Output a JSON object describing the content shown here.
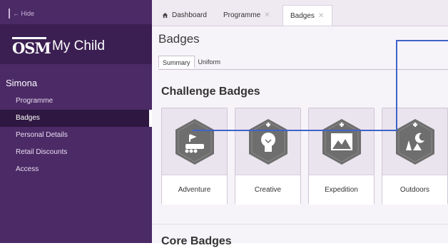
{
  "sidebar": {
    "hide_label": "← Hide",
    "logo_text": "OSM",
    "title": "My Child",
    "child_name": "Simona",
    "items": [
      {
        "label": "Programme"
      },
      {
        "label": "Badges"
      },
      {
        "label": "Personal Details"
      },
      {
        "label": "Retail Discounts"
      },
      {
        "label": "Access"
      }
    ]
  },
  "tabs": [
    {
      "label": "Dashboard",
      "icon": "home-icon",
      "closable": false
    },
    {
      "label": "Programme",
      "closable": true
    },
    {
      "label": "Badges",
      "closable": true,
      "active": true
    }
  ],
  "main": {
    "page_title": "Badges",
    "subtabs": [
      {
        "label": "Summary",
        "active": true
      },
      {
        "label": "Uniform"
      }
    ],
    "section_title": "Challenge Badges",
    "badges": [
      {
        "label": "Adventure",
        "icon": "adventure-icon"
      },
      {
        "label": "Creative",
        "icon": "lightbulb-icon"
      },
      {
        "label": "Expedition",
        "icon": "mountain-icon"
      },
      {
        "label": "Outdoors",
        "icon": "camp-night-icon"
      }
    ],
    "core_title": "Core Badges"
  },
  "colors": {
    "sidebar": "#4b2a66",
    "sidebar_dark": "#3b1f52",
    "badge_hex": "#6e6e6e",
    "annotation_line": "#3f63c8"
  }
}
